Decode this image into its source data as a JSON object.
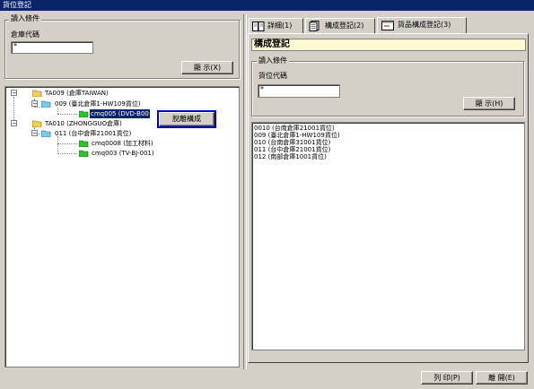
{
  "window": {
    "title": "貨位登記"
  },
  "left": {
    "filter_legend": "讀入條件",
    "warehouse_label": "倉庫代碼",
    "warehouse_value": "*",
    "show_button": "顯 示(X)",
    "tree": [
      {
        "label": "TA009 (倉庫TAIWAN)"
      },
      {
        "label": "009 (臺北倉庫1-HW109貨位)"
      },
      {
        "label": "cmq005 (DVD-B00"
      },
      {
        "label": "TA010 (ZHONGGUO倉庫)"
      },
      {
        "label": "011 (台中倉庫21001貨位)"
      },
      {
        "label": "cmq0008 (加工材料)"
      },
      {
        "label": "cmq003 (TV-BJ-001)"
      }
    ],
    "context_menu_item": "脫離構成"
  },
  "tabs": [
    {
      "label": "詳細(1)"
    },
    {
      "label": "構成登記(2)"
    },
    {
      "label": "貨品構成登記(3)"
    }
  ],
  "right": {
    "header": "構成登記",
    "filter_legend": "讀入條件",
    "location_label": "貨位代碼",
    "location_value": "*",
    "show_button": "顯 示(H)",
    "list": [
      "0010 (台南倉庫21001貨位)",
      "009 (臺北倉庫1-HW109貨位)",
      "010 (台南倉庫31001貨位)",
      "011 (台中倉庫21001貨位)",
      "012 (南部倉庫1001貨位)"
    ]
  },
  "footer": {
    "print_button": "列 印(P)",
    "close_button": "離 開(E)"
  },
  "colors": {
    "titlebar": "#0a246a",
    "selection": "#0a246a",
    "header_bg": "#fffbd0"
  }
}
